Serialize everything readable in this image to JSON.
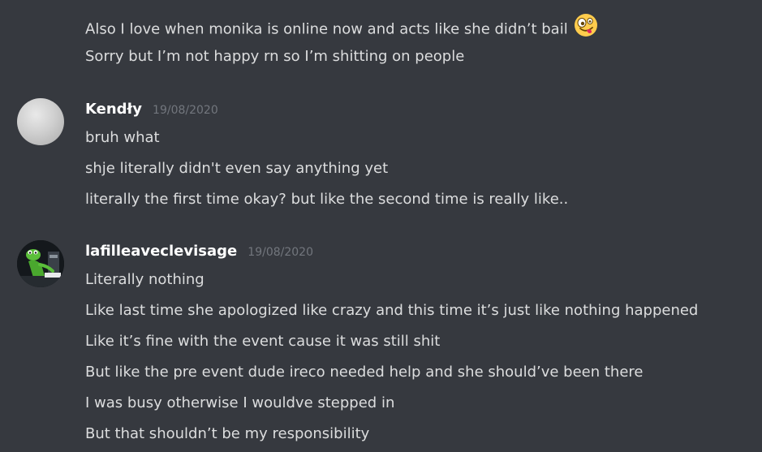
{
  "messages": {
    "previous": {
      "lines": [
        "Also I love when monika is online now and acts like she didn’t bail",
        "Sorry but I’m not happy rn so I’m shitting on people"
      ],
      "emoji": "zany-face-emoji"
    },
    "kendly": {
      "username": "Kendły",
      "timestamp": "19/08/2020",
      "lines": [
        "bruh what",
        "shje literally didn't even say anything yet",
        "literally the first time okay? but like the second time is really like.."
      ]
    },
    "lafille": {
      "username": "lafilleaveclevisage",
      "timestamp": "19/08/2020",
      "lines": [
        "Literally nothing",
        "Like last time she apologized like crazy and this time it’s just like nothing happened",
        "Like it’s fine with the event cause it was still shit",
        "But like the pre event dude ireco needed help and she should’ve been there",
        "I was busy otherwise I wouldve stepped in",
        "But that shouldn’t be my responsibility"
      ]
    }
  },
  "colors": {
    "background": "#36393f",
    "text": "#dcddde",
    "username": "#ffffff",
    "timestamp": "#72767d"
  }
}
